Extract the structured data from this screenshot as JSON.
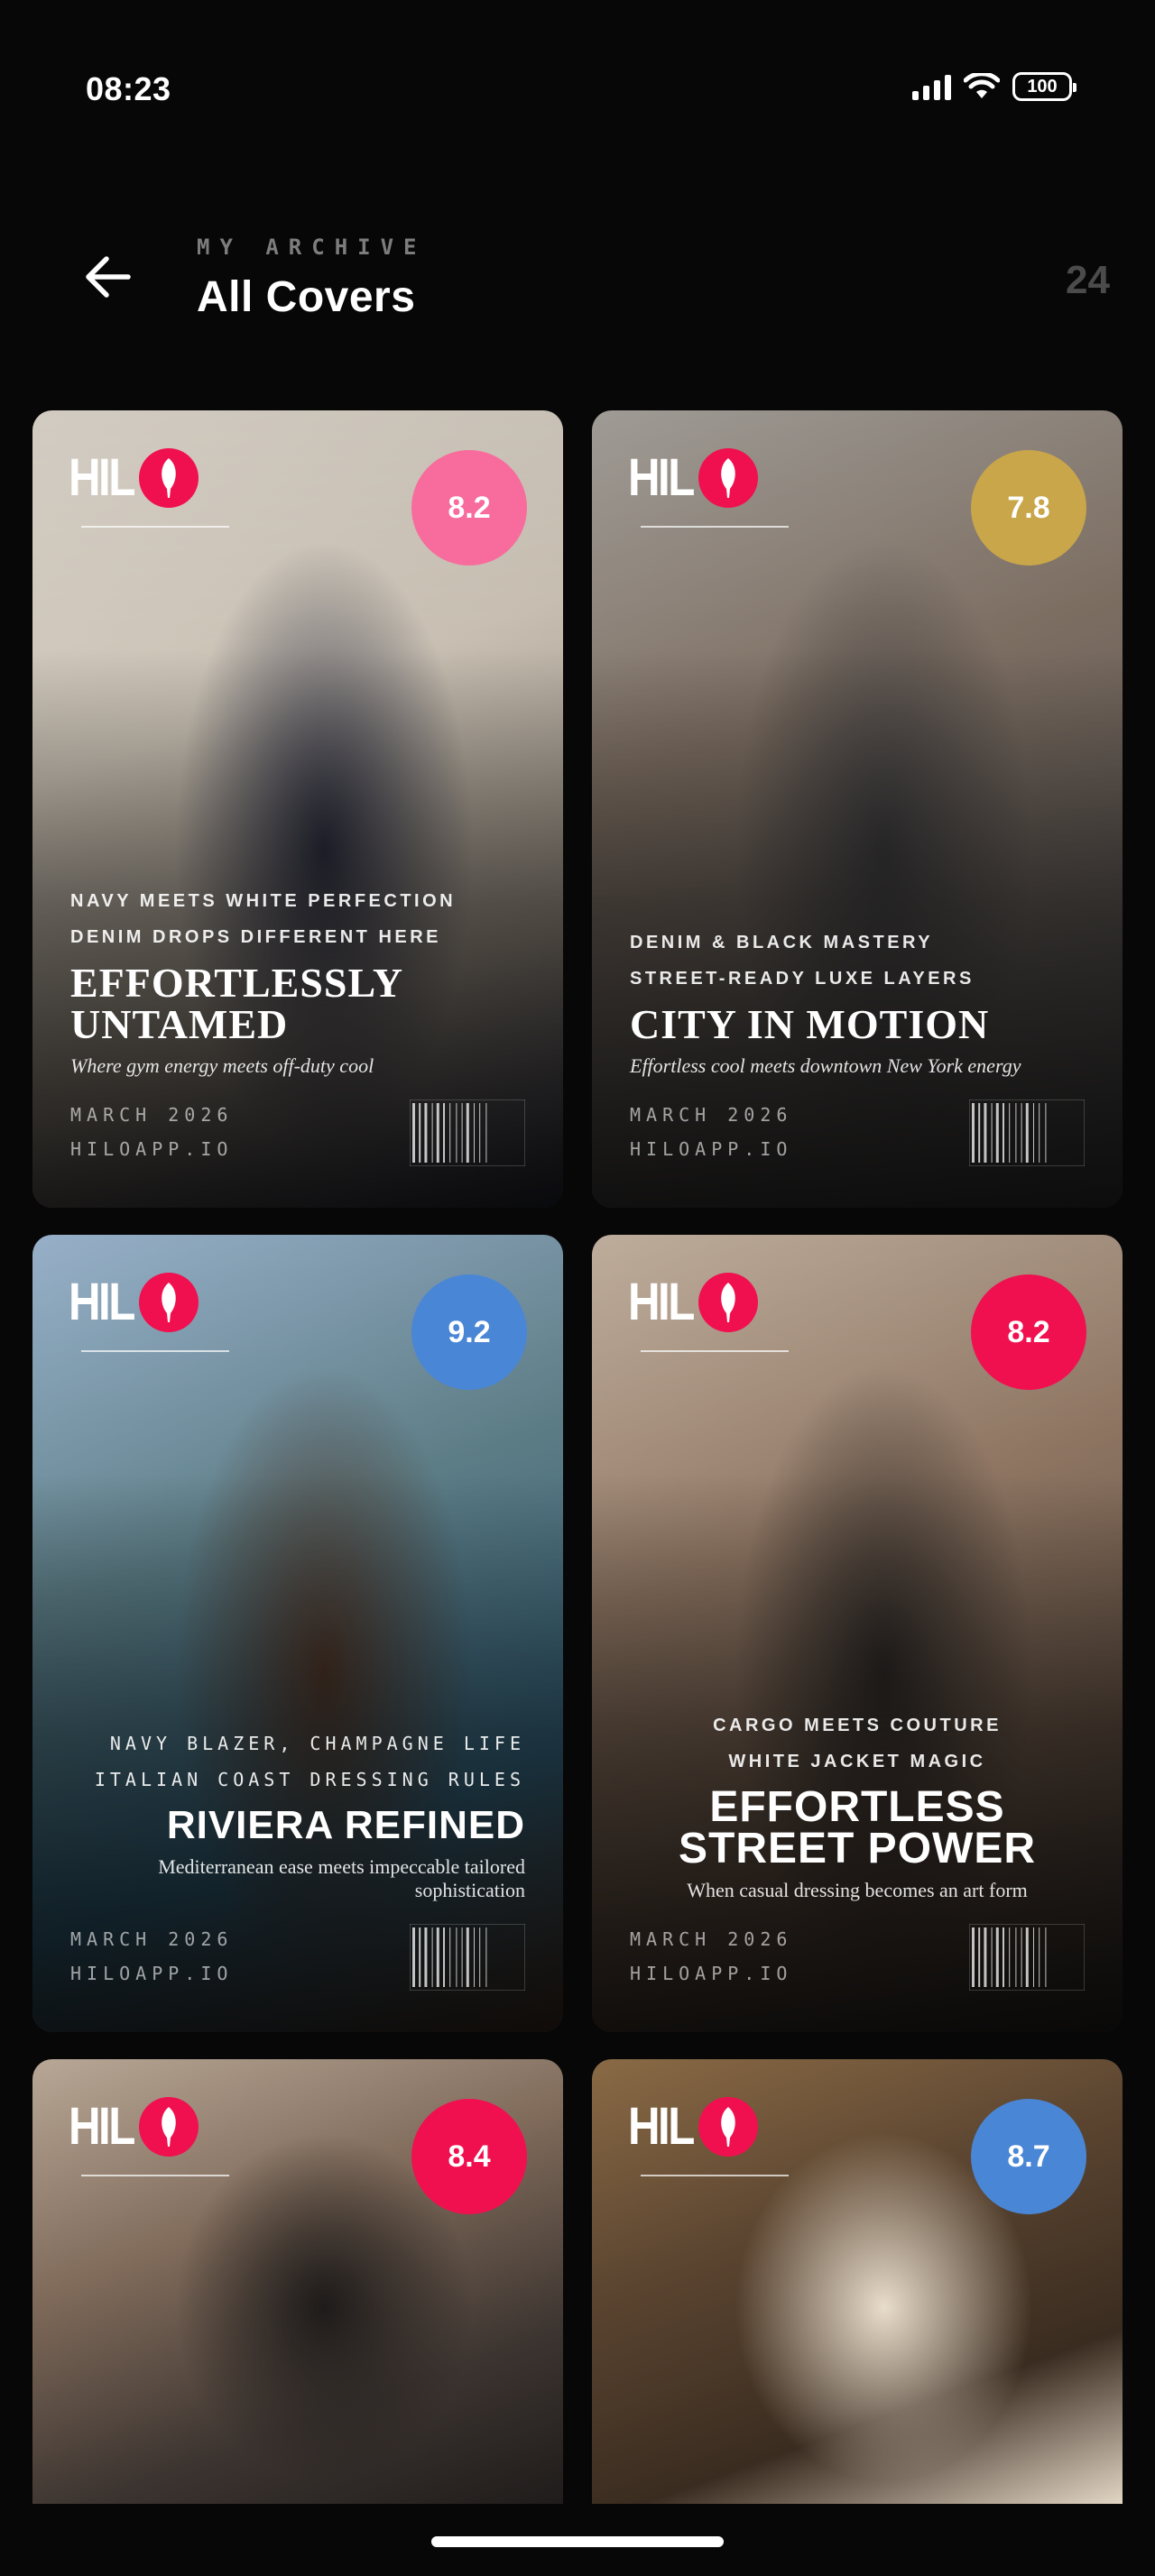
{
  "status_bar": {
    "time": "08:23",
    "battery": "100",
    "icons": [
      "signal-icon",
      "wifi-icon",
      "battery-icon"
    ]
  },
  "header": {
    "eyebrow": "MY ARCHIVE",
    "title": "All Covers",
    "count": "24",
    "back_icon": "arrow-left-icon"
  },
  "brand": {
    "logo": "HIL",
    "accent": "#f0104f"
  },
  "covers": [
    {
      "score": "8.2",
      "score_color": "#f76c9c",
      "kicker1": "NAVY MEETS WHITE PERFECTION",
      "kicker2": "DENIM DROPS DIFFERENT HERE",
      "headline": "EFFORTLESSLY UNTAMED",
      "tagline": "Where gym energy meets off-duty cool",
      "issue": "MARCH 2026",
      "site": "HILOAPP.IO",
      "palette": [
        "#ddd6cc",
        "#c9c0b3",
        "#8b8277",
        "#2a2c3c"
      ]
    },
    {
      "score": "7.8",
      "score_color": "#c9a64a",
      "kicker1": "DENIM & BLACK MASTERY",
      "kicker2": "STREET-READY LUXE LAYERS",
      "headline": "CITY IN MOTION",
      "tagline": "Effortless cool meets downtown New York energy",
      "issue": "MARCH 2026",
      "site": "HILOAPP.IO",
      "palette": [
        "#a7a39d",
        "#7d6e62",
        "#55504d",
        "#3b3a3c"
      ]
    },
    {
      "score": "9.2",
      "score_color": "#4a86d6",
      "kicker1": "NAVY BLAZER, CHAMPAGNE LIFE",
      "kicker2": "ITALIAN COAST DRESSING RULES",
      "headline": "RIVIERA REFINED",
      "tagline": "Mediterranean ease meets impeccable tailored sophistication",
      "issue": "MARCH 2026",
      "site": "HILOAPP.IO",
      "palette": [
        "#9fb9d3",
        "#5d7d86",
        "#305c73",
        "#4a3428"
      ]
    },
    {
      "score": "8.2",
      "score_color": "#f0104f",
      "kicker1": "CARGO MEETS COUTURE",
      "kicker2": "WHITE JACKET MAGIC",
      "headline": "EFFORTLESS STREET POWER",
      "tagline": "When casual dressing becomes an art form",
      "issue": "MARCH 2026",
      "site": "HILOAPP.IO",
      "palette": [
        "#c8b6a4",
        "#8f7663",
        "#5b4a3e",
        "#2b2725"
      ]
    },
    {
      "score": "8.4",
      "score_color": "#f0104f",
      "palette": [
        "#b8a796",
        "#7f6a5a",
        "#3c3430",
        "#1e1b1a"
      ]
    },
    {
      "score": "8.7",
      "score_color": "#4a86d6",
      "palette": [
        "#8a6a45",
        "#5a4430",
        "#3a2c20",
        "#e8dccb"
      ]
    }
  ]
}
